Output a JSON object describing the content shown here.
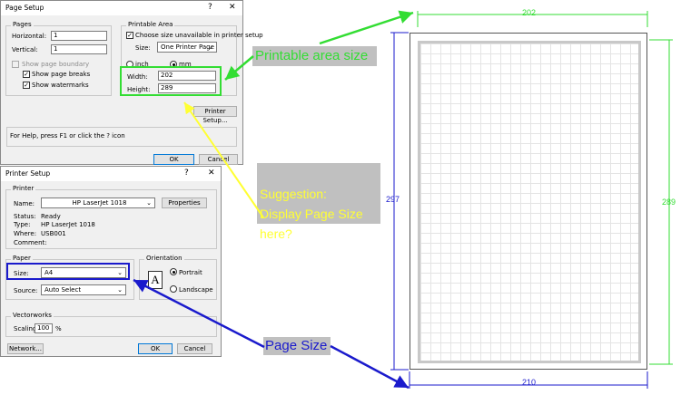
{
  "page_setup": {
    "title": "Page Setup",
    "help_btn": "?",
    "close_btn": "✕",
    "pages_group": "Pages",
    "horizontal_label": "Horizontal:",
    "horizontal_value": "1",
    "vertical_label": "Vertical:",
    "vertical_value": "1",
    "show_boundary": "Show page boundary",
    "show_breaks": "Show page breaks",
    "show_watermarks": "Show watermarks",
    "printable_group": "Printable Area",
    "choose_size": "Choose size unavailable in printer setup",
    "size_label": "Size:",
    "size_value": "One Printer Page",
    "unit_inch": "inch",
    "unit_mm": "mm",
    "width_label": "Width:",
    "width_value": "202",
    "height_label": "Height:",
    "height_value": "289",
    "printer_setup_btn": "Printer Setup...",
    "help_text": "For Help, press F1 or click the ? icon",
    "ok": "OK",
    "cancel": "Cancel"
  },
  "printer_setup": {
    "title": "Printer Setup",
    "help_btn": "?",
    "close_btn": "✕",
    "printer_group": "Printer",
    "name_label": "Name:",
    "name_value": "HP LaserJet 1018",
    "properties_btn": "Properties",
    "status_label": "Status:",
    "status_value": "Ready",
    "type_label": "Type:",
    "type_value": "HP LaserJet 1018",
    "where_label": "Where:",
    "where_value": "USB001",
    "comment_label": "Comment:",
    "paper_group": "Paper",
    "size_label": "Size:",
    "size_value": "A4",
    "source_label": "Source:",
    "source_value": "Auto Select",
    "orientation_group": "Orientation",
    "portrait": "Portrait",
    "landscape": "Landscape",
    "orientation_glyph": "A",
    "vectorworks_group": "Vectorworks",
    "scaling_label": "Scaling:",
    "scaling_value": "100",
    "scaling_unit": "%",
    "network_btn": "Network...",
    "ok": "OK",
    "cancel": "Cancel"
  },
  "annotations": {
    "printable_area_size": "Printable area size",
    "suggestion": "Suggestion:\nDisplay Page Size\nhere?",
    "page_size": "Page Size"
  },
  "dimensions": {
    "printable_width": "202",
    "printable_height": "289",
    "page_width": "210",
    "page_height": "297"
  },
  "colors": {
    "green": "#33dd33",
    "yellow": "#ffff33",
    "blue": "#1a1acc",
    "callout_bg": "#c0c0c0"
  }
}
